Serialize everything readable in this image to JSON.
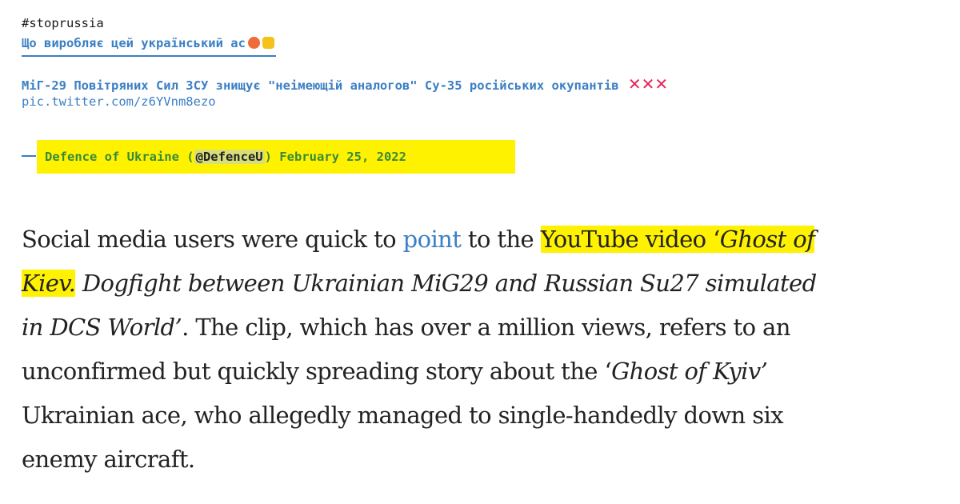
{
  "tweet": {
    "hashtag": "#stoprussia",
    "headline": "Що виробляє цей український ас",
    "claim": "МіГ-29 Повітряних Сил ЗСУ знищує \"неімеющій аналогов\" Су-35 російських окупантів",
    "x_marks": "✕✕✕",
    "pic_link": "pic.twitter.com/z6YVnm8ezo",
    "signature": {
      "author": "Defence of Ukraine (",
      "handle": "@DefenceU",
      "close": ") February 25, 2022"
    }
  },
  "article": {
    "l1_a": "Social media users were quick to ",
    "l1_link": "point",
    "l1_b": " to the ",
    "l1_hl": "YouTube video ‘",
    "l1_hl_it": "Ghost of",
    "l2_hl_it": "Kiev.",
    "l2_it": " Dogfight between Ukrainian MiG29 and Russian Su27 simulated",
    "l3_it": "in DCS World’",
    "l3": ". The clip, which has over a million views, refers to an",
    "l4_a": "unconfirmed but quickly spreading story about the ‘",
    "l4_it": "Ghost of Kyiv’",
    "l5": "Ukrainian ace, who allegedly managed to single-handedly down six",
    "l6": "enemy aircraft."
  },
  "colors": {
    "link_blue": "#3b7fc4",
    "highlight_yellow": "#fff200",
    "x_mark_red": "#e3245a",
    "signature_green": "#3a8a3a"
  }
}
